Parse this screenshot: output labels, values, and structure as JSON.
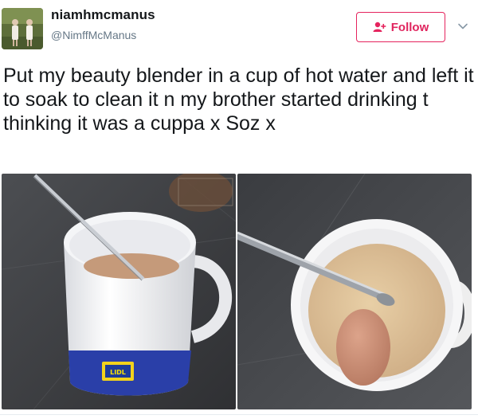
{
  "tweet": {
    "display_name": "niamhmcmanus",
    "handle": "@NimffMcManus",
    "follow_label": "Follow",
    "text": "Put my beauty blender in a cup of hot water and left it to soak to clean it n my brother started drinking t thinking it was a cuppa x Soz x"
  },
  "photos": {
    "mug_logo_text": "LIDL"
  },
  "colors": {
    "follow": "#e5245e",
    "handle": "#657786",
    "text": "#14171a"
  },
  "icons": {
    "follow": "add-user-icon",
    "menu": "chevron-down-icon"
  }
}
